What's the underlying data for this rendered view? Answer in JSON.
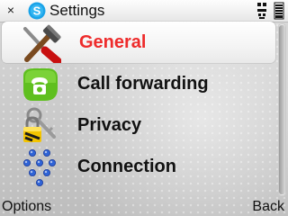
{
  "titlebar": {
    "close_glyph": "×",
    "title": "Settings",
    "logo_icon": "skype-logo-icon",
    "status_icon": "network-status-icon",
    "battery_icon": "battery-icon"
  },
  "list": {
    "items": [
      {
        "label": "General",
        "icon": "tools-icon",
        "selected": true
      },
      {
        "label": "Call forwarding",
        "icon": "phone-icon",
        "selected": false
      },
      {
        "label": "Privacy",
        "icon": "lock-keys-icon",
        "selected": false
      },
      {
        "label": "Connection",
        "icon": "network-nodes-icon",
        "selected": false
      }
    ]
  },
  "softkeys": {
    "left": "Options",
    "right": "Back"
  },
  "colors": {
    "selected_text": "#ee2b2b",
    "text": "#111111",
    "skype_blue": "#1aa3e8"
  }
}
